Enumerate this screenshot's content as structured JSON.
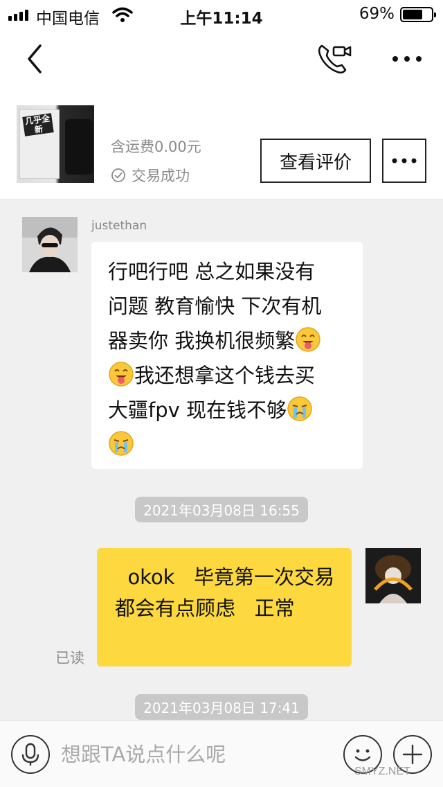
{
  "status_bar": {
    "carrier": "中国电信",
    "time": "上午11:14",
    "battery_pct": "69%",
    "battery_level": 0.69
  },
  "nav": {
    "icons": [
      "chevron-left-icon",
      "video-call-icon",
      "more-icon"
    ]
  },
  "product": {
    "thumb_label": "几乎全新",
    "price": "含运费0.00元",
    "trade_status": "交易成功",
    "review_button": "查看评价"
  },
  "chat": {
    "other": {
      "name": "justethan",
      "message_lines": [
        "行吧行吧 总之如果没有",
        "问题 教育愉快 下次有机",
        "器卖你 我换机很频繁",
        "我还想拿这个钱去买",
        "大疆fpv 现在钱不够"
      ]
    },
    "timestamp_1": "2021年03月08日 16:55",
    "me": {
      "message": "  okok   毕竟第一次交易   都会有点顾虑   正常",
      "read_status": "已读"
    },
    "timestamp_2": "2021年03月08日 17:41"
  },
  "input": {
    "placeholder": "想跟TA说点什么呢"
  },
  "watermark": "SMYZ.NET",
  "colors": {
    "my_bubble": "#fdd83e",
    "background": "#f0f0f0",
    "timestamp_pill": "#c8c8c8"
  }
}
